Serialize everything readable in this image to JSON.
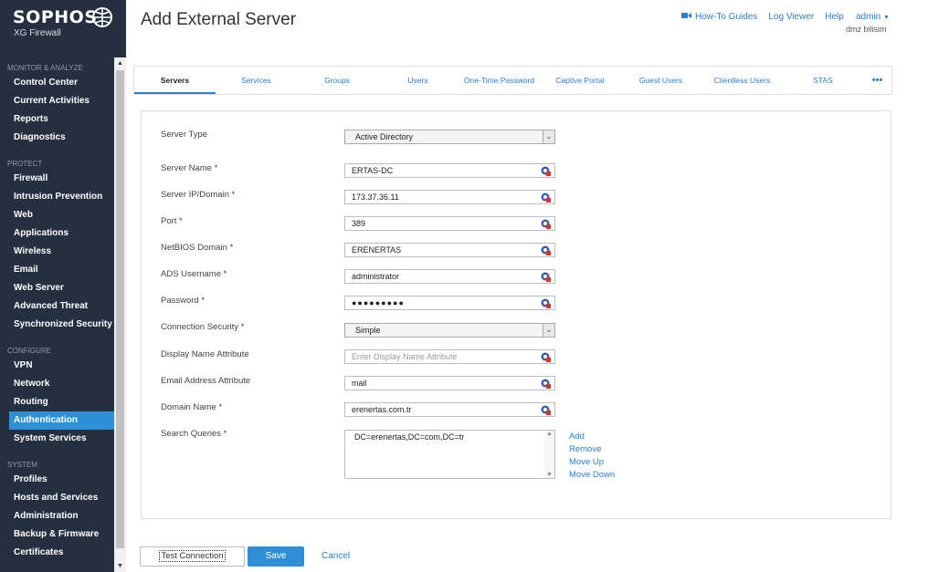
{
  "brand": {
    "name": "SOPHOS",
    "product": "XG Firewall"
  },
  "sidebar": {
    "sections": [
      {
        "title": "MONITOR & ANALYZE",
        "items": [
          "Control Center",
          "Current Activities",
          "Reports",
          "Diagnostics"
        ]
      },
      {
        "title": "PROTECT",
        "items": [
          "Firewall",
          "Intrusion Prevention",
          "Web",
          "Applications",
          "Wireless",
          "Email",
          "Web Server",
          "Advanced Threat",
          "Synchronized Security"
        ]
      },
      {
        "title": "CONFIGURE",
        "items": [
          "VPN",
          "Network",
          "Routing",
          "Authentication",
          "System Services"
        ]
      },
      {
        "title": "SYSTEM",
        "items": [
          "Profiles",
          "Hosts and Services",
          "Administration",
          "Backup & Firmware",
          "Certificates"
        ]
      }
    ],
    "active_item": "Authentication"
  },
  "header": {
    "title": "Add External Server",
    "links": {
      "howto": "How-To Guides",
      "log_viewer": "Log Viewer",
      "help": "Help"
    },
    "user": "admin",
    "org": "dmz bilisim"
  },
  "tabs": [
    "Servers",
    "Services",
    "Groups",
    "Users",
    "One-Time Password",
    "Captive Portal",
    "Guest Users",
    "Clientless Users",
    "STAS",
    "•••"
  ],
  "form": {
    "server_type": {
      "label": "Server Type",
      "value": "Active Directory"
    },
    "server_name": {
      "label": "Server Name *",
      "value": "ERTAS-DC"
    },
    "server_ip": {
      "label": "Server IP/Domain *",
      "value": "173.37.36.11"
    },
    "port": {
      "label": "Port *",
      "value": "389"
    },
    "netbios": {
      "label": "NetBIOS Domain *",
      "value": "ERENERTAS"
    },
    "ads_username": {
      "label": "ADS Username *",
      "value": "administrator"
    },
    "password": {
      "label": "Password *",
      "value": "●●●●●●●●●"
    },
    "connection_security": {
      "label": "Connection Security *",
      "value": "Simple"
    },
    "display_name_attr": {
      "label": "Display Name Attribute",
      "placeholder": "Enter Display Name Attribute"
    },
    "email_attr": {
      "label": "Email Address Attribute",
      "value": "mail"
    },
    "domain_name": {
      "label": "Domain Name *",
      "value": "erenertas.com.tr"
    },
    "search_queries": {
      "label": "Search Queries *",
      "value": "DC=erenertas,DC=com,DC=tr"
    },
    "query_actions": {
      "add": "Add",
      "remove": "Remove",
      "move_up": "Move Up",
      "move_down": "Move Down"
    }
  },
  "footer": {
    "test": "Test Connection",
    "save": "Save",
    "cancel": "Cancel"
  },
  "colors": {
    "sidebar_bg": "#24303f",
    "accent": "#2f8fd6",
    "link": "#2a7fcf"
  }
}
